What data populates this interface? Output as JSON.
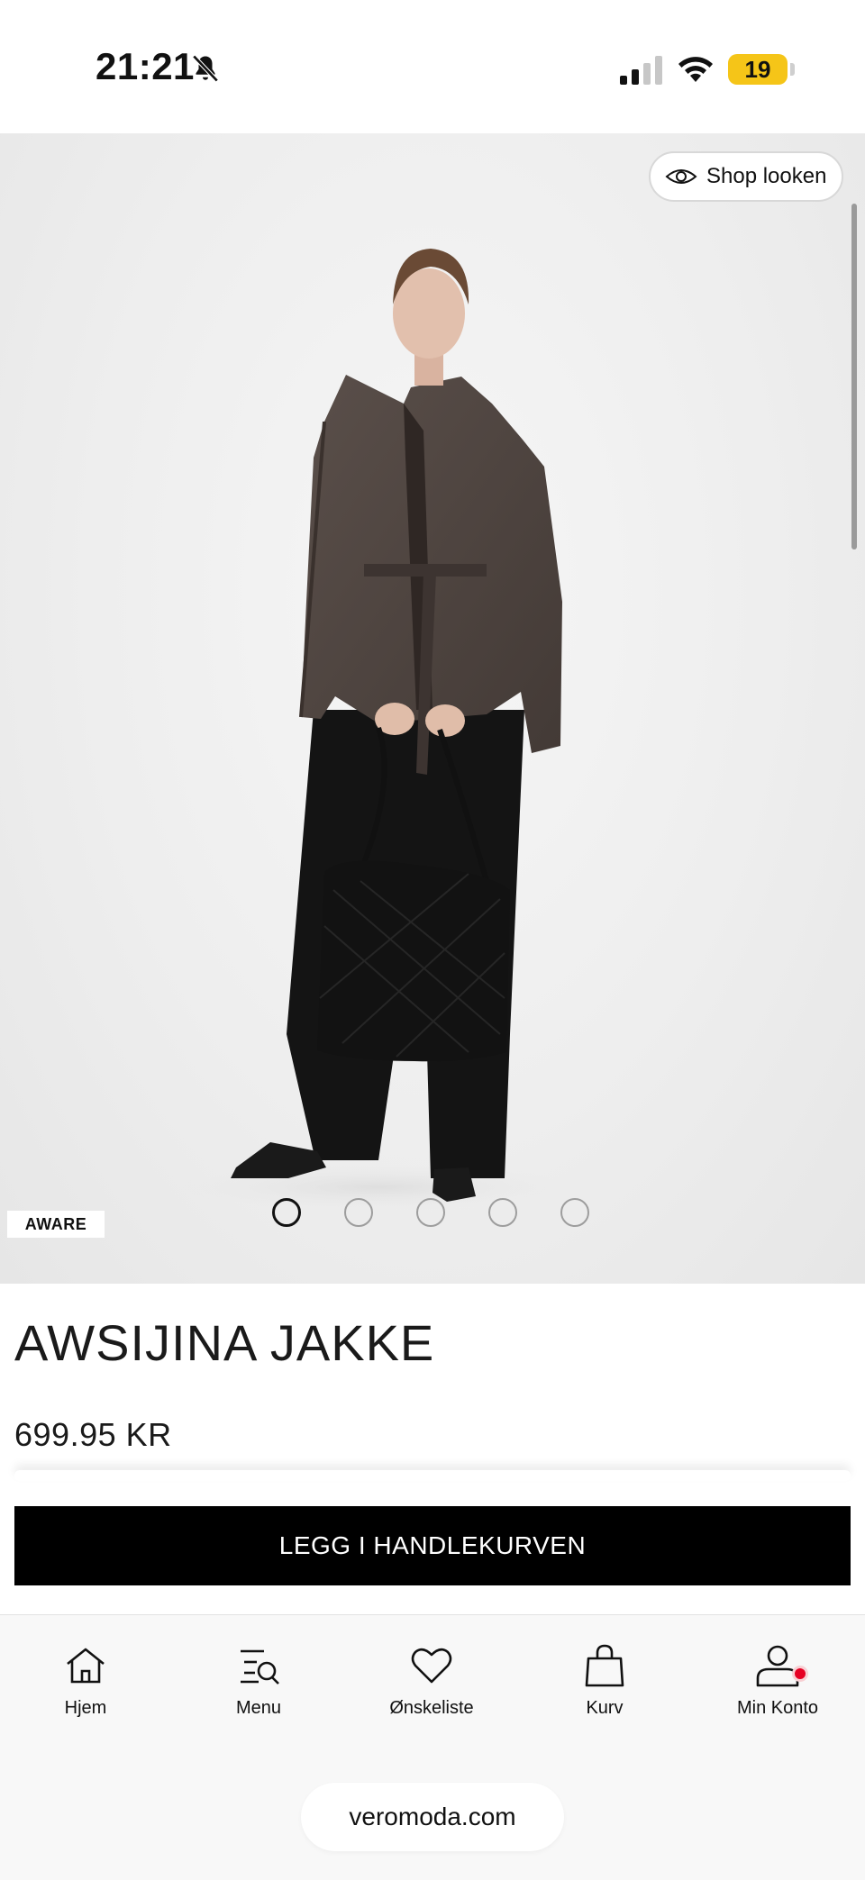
{
  "status_bar": {
    "time": "21:21",
    "battery_percent": 19,
    "battery_label": "19",
    "icons": [
      "bell-slash-icon",
      "signal-icon",
      "wifi-icon",
      "battery-icon"
    ]
  },
  "hero": {
    "shop_look_label": "Shop looken",
    "badge": "AWARE",
    "carousel": {
      "count": 5,
      "active_index": 0
    }
  },
  "product": {
    "name": "AWSIJINA JAKKE",
    "price": "699.95 KR",
    "add_to_cart_label": "LEGG I HANDLEKURVEN"
  },
  "nav": {
    "items": [
      {
        "label": "Hjem",
        "icon": "home-icon"
      },
      {
        "label": "Menu",
        "icon": "menu-search-icon"
      },
      {
        "label": "Ønskeliste",
        "icon": "heart-icon"
      },
      {
        "label": "Kurv",
        "icon": "bag-icon"
      },
      {
        "label": "Min Konto",
        "icon": "user-icon"
      }
    ]
  },
  "browser": {
    "url": "veromoda.com"
  },
  "colors": {
    "button_bg": "#000000",
    "battery": "#f5c518",
    "notification": "#e60023"
  }
}
